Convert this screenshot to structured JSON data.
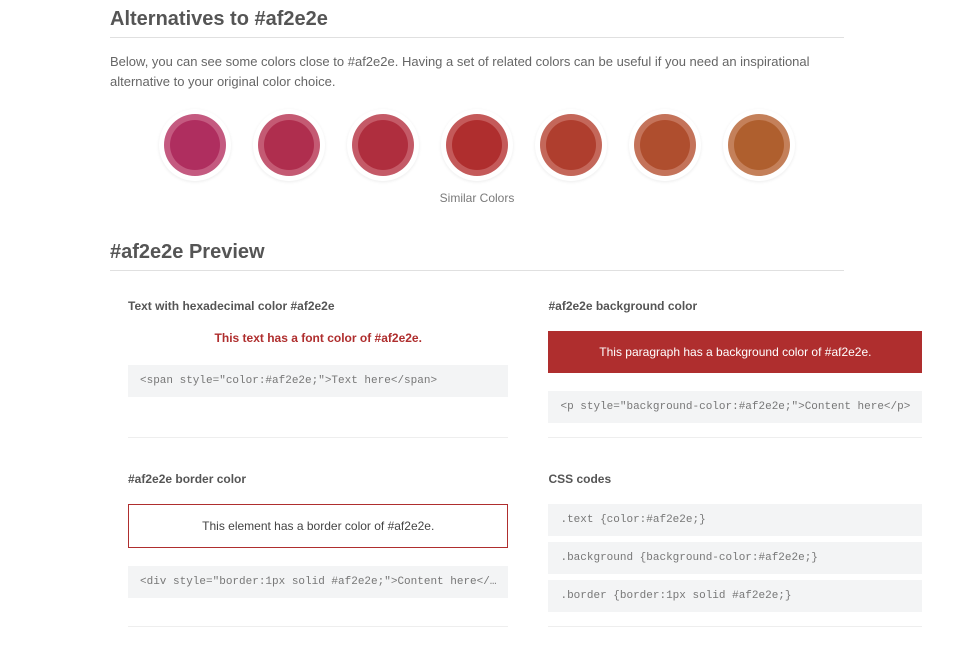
{
  "base_color": "#af2e2e",
  "alternatives": {
    "title": "Alternatives to #af2e2e",
    "intro": "Below, you can see some colors close to #af2e2e. Having a set of related colors can be useful if you need an inspirational alternative to your original color choice.",
    "caption": "Similar Colors",
    "swatches": [
      {
        "hex": "#af2e5f",
        "ring": "#c45a80"
      },
      {
        "hex": "#af2e4e",
        "ring": "#c45a73"
      },
      {
        "hex": "#af2e3e",
        "ring": "#c45a67"
      },
      {
        "hex": "#af2e2e",
        "ring": "#c45a5a"
      },
      {
        "hex": "#af3e2e",
        "ring": "#c4675a"
      },
      {
        "hex": "#af4e2e",
        "ring": "#c4735a"
      },
      {
        "hex": "#af5f2e",
        "ring": "#c4805a"
      }
    ]
  },
  "preview": {
    "title": "#af2e2e Preview",
    "text": {
      "heading": "Text with hexadecimal color #af2e2e",
      "sample": "This text has a font color of #af2e2e.",
      "code": "<span style=\"color:#af2e2e;\">Text here</span>"
    },
    "bg": {
      "heading": "#af2e2e background color",
      "sample": "This paragraph has a background color of #af2e2e.",
      "code": "<p style=\"background-color:#af2e2e;\">Content here</p>"
    },
    "border": {
      "heading": "#af2e2e border color",
      "sample": "This element has a border color of #af2e2e.",
      "code": "<div style=\"border:1px solid #af2e2e;\">Content here</…"
    },
    "css": {
      "heading": "CSS codes",
      "lines": [
        ".text {color:#af2e2e;}",
        ".background {background-color:#af2e2e;}",
        ".border {border:1px solid #af2e2e;}"
      ]
    }
  }
}
